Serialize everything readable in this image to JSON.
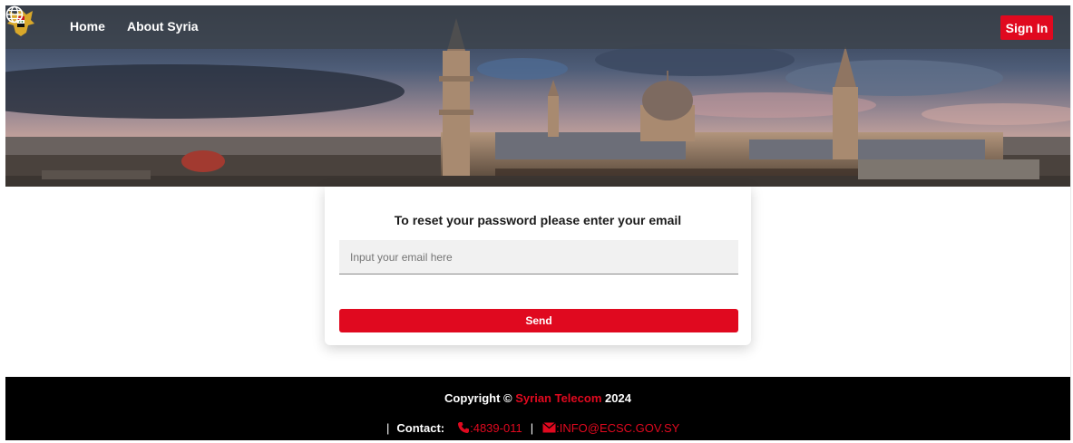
{
  "navbar": {
    "links": [
      "Home",
      "About Syria"
    ],
    "sign_in_label": "Sign In"
  },
  "icons": {
    "logo": "syrian-eagle-emblem-icon",
    "language": "globe-icon",
    "phone": "phone-icon",
    "email": "envelope-icon"
  },
  "reset_form": {
    "title": "To reset your password please enter your email",
    "email_placeholder": "Input your email here",
    "email_value": "",
    "send_label": "Send"
  },
  "footer": {
    "copyright_prefix": "Copyright ©",
    "company": "Syrian Telecom",
    "year": "2024",
    "separator": "|",
    "contact_label": "Contact:",
    "phone": ":4839-011",
    "email": ":INFO@ECSC.GOV.SY"
  },
  "colors": {
    "accent": "#e0091f",
    "footer_bg": "#000000",
    "navbar_bg": "#3c424a"
  }
}
